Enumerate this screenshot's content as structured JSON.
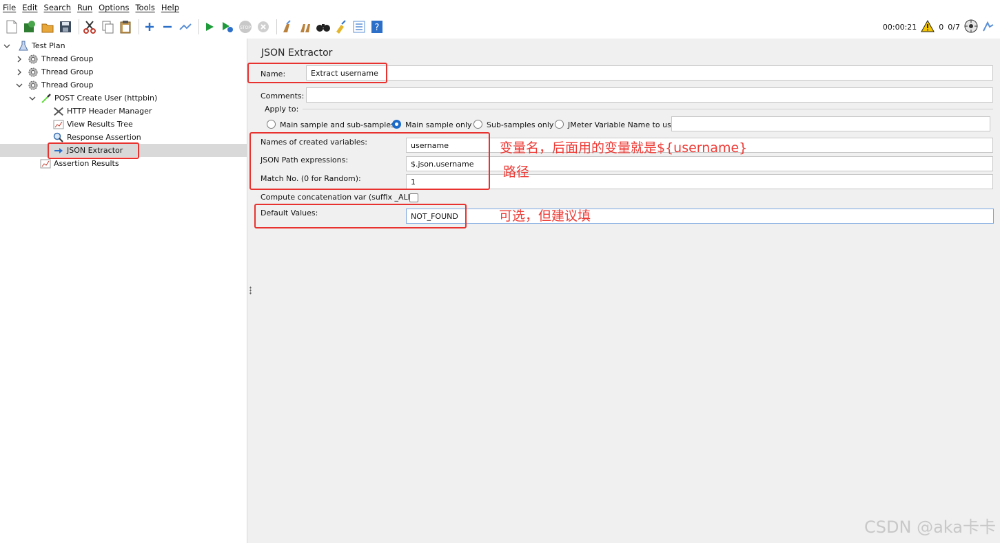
{
  "menu": [
    "File",
    "Edit",
    "Search",
    "Run",
    "Options",
    "Tools",
    "Help"
  ],
  "toolbar": {
    "timer": "00:00:21",
    "warning_count": "0",
    "threads": "0/7"
  },
  "tree": {
    "items": [
      {
        "label": "Test Plan",
        "icon": "flask-icon"
      },
      {
        "label": "Thread Group",
        "icon": "gear-icon"
      },
      {
        "label": "Thread Group",
        "icon": "gear-icon"
      },
      {
        "label": "Thread Group",
        "icon": "gear-icon"
      },
      {
        "label": "POST Create User (httpbin)",
        "icon": "pipette-icon"
      },
      {
        "label": "HTTP Header Manager",
        "icon": "tools-icon"
      },
      {
        "label": "View Results Tree",
        "icon": "chart-icon"
      },
      {
        "label": "Response Assertion",
        "icon": "magnifier-icon"
      },
      {
        "label": "JSON Extractor",
        "icon": "arrow-icon"
      },
      {
        "label": "Assertion Results",
        "icon": "chart-icon"
      }
    ]
  },
  "panel": {
    "title": "JSON Extractor",
    "name_label": "Name:",
    "name_value": "Extract username",
    "comments_label": "Comments:",
    "comments_value": "",
    "apply_to_label": "Apply to:",
    "apply_options": [
      "Main sample and sub-samples",
      "Main sample only",
      "Sub-samples only",
      "JMeter Variable Name to use"
    ],
    "apply_selected": "Main sample only",
    "jmeter_var_value": "",
    "names_label": "Names of created variables:",
    "names_value": "username",
    "json_path_label": "JSON Path expressions:",
    "json_path_value": "$.json.username",
    "match_label": "Match No. (0 for Random):",
    "match_value": "1",
    "concat_label": "Compute concatenation var (suffix _ALL):",
    "concat_checked": false,
    "default_label": "Default Values:",
    "default_value": "NOT_FOUND"
  },
  "annotations": {
    "var_name": "变量名，后面用的变量就是${username}",
    "path": "路径",
    "optional": "可选，但建议填"
  },
  "watermark": "CSDN @aka卡卡",
  "colors": {
    "annotation_red": "#e8322f",
    "radio_blue": "#1b6ac9",
    "selection_gray": "#d9d9d9"
  }
}
